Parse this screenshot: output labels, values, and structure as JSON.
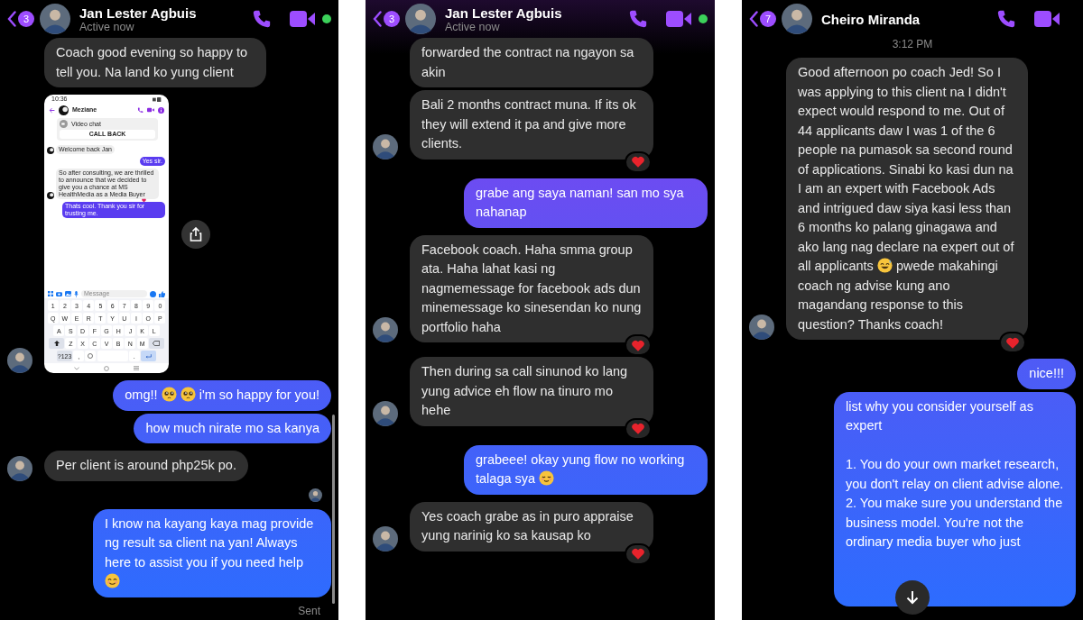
{
  "panels": [
    {
      "header": {
        "name": "Jan Lester Agbuis",
        "status": "Active now",
        "unread": "3",
        "online": true
      },
      "scroll_down": false,
      "scrollbar": true,
      "messages": [
        {
          "kind": "incoming",
          "avatar": false,
          "reaction": false,
          "parts": [
            {
              "kind": "text",
              "text": "Coach good evening so happy to tell you. Na land ko yung client"
            }
          ]
        },
        {
          "kind": "screenshot",
          "avatar": true,
          "share": true,
          "phone": {
            "time": "10:36",
            "contact": "Meziane",
            "call_title": "Video chat",
            "call_button": "CALL BACK",
            "messages": [
              {
                "kind": "incoming",
                "text": "Welcome back Jan",
                "reaction": false
              },
              {
                "kind": "outgoing",
                "text": "Yes sir.",
                "reaction": false
              },
              {
                "kind": "incoming",
                "text": "So after consulting, we are thrilled to announce that we decided to give you a chance at MS HealthMedia as a Media Buyer",
                "reaction": true
              },
              {
                "kind": "outgoing",
                "text": "Thats cool. Thank you sir for trusting me.",
                "reaction": false
              }
            ],
            "composer": {
              "placeholder": "Message"
            },
            "keys": [
              [
                "1",
                "2",
                "3",
                "4",
                "5",
                "6",
                "7",
                "8",
                "9",
                "0"
              ],
              [
                "Q",
                "W",
                "E",
                "R",
                "T",
                "Y",
                "U",
                "I",
                "O",
                "P"
              ],
              [
                "A",
                "S",
                "D",
                "F",
                "G",
                "H",
                "J",
                "K",
                "L"
              ],
              [
                "Z",
                "X",
                "C",
                "V",
                "B",
                "N",
                "M"
              ]
            ],
            "mode_key": "?123",
            "comma": ",",
            "period": "."
          }
        },
        {
          "kind": "outgoing",
          "reaction": false,
          "parts": [
            {
              "kind": "text",
              "text": "omg!!"
            },
            {
              "kind": "pleading"
            },
            {
              "kind": "pleading"
            },
            {
              "kind": "text",
              "text": "i'm so happy for you!"
            }
          ]
        },
        {
          "kind": "outgoing",
          "reaction": false,
          "parts": [
            {
              "kind": "text",
              "text": "how much nirate mo sa kanya"
            }
          ]
        },
        {
          "kind": "incoming",
          "avatar": true,
          "reaction": false,
          "parts": [
            {
              "kind": "text",
              "text": "Per client is around php25k po."
            }
          ]
        },
        {
          "kind": "receipt"
        },
        {
          "kind": "outgoing",
          "reaction": false,
          "parts": [
            {
              "kind": "text",
              "text": "I know na kayang kaya mag provide ng result sa client na yan! Always here to assist you if you need help"
            },
            {
              "kind": "smiling"
            }
          ]
        },
        {
          "kind": "status",
          "text": "Sent"
        }
      ]
    },
    {
      "header": {
        "name": "Jan Lester Agbuis",
        "status": "Active now",
        "unread": "3",
        "online": true
      },
      "scroll_down": false,
      "scrollbar": false,
      "messages": [
        {
          "kind": "incoming",
          "avatar": false,
          "reaction": false,
          "parts": [
            {
              "kind": "text",
              "text": "forwarded the contract na ngayon sa akin"
            }
          ]
        },
        {
          "kind": "incoming",
          "avatar": true,
          "reaction": true,
          "parts": [
            {
              "kind": "text",
              "text": "Bali 2 months contract muna. If its ok they will extend it pa and give more clients."
            }
          ]
        },
        {
          "kind": "outgoing",
          "reaction": false,
          "parts": [
            {
              "kind": "text",
              "text": "grabe ang saya naman! san mo sya nahanap"
            }
          ]
        },
        {
          "kind": "incoming",
          "avatar": true,
          "reaction": true,
          "parts": [
            {
              "kind": "text",
              "text": "Facebook coach. Haha smma group ata. Haha lahat kasi ng nagmemessage for facebook ads dun minemessage ko sinesendan ko nung portfolio haha"
            }
          ]
        },
        {
          "kind": "incoming",
          "avatar": true,
          "reaction": true,
          "parts": [
            {
              "kind": "text",
              "text": "Then during sa call sinunod ko lang yung advice eh flow na tinuro mo hehe"
            }
          ]
        },
        {
          "kind": "outgoing",
          "reaction": false,
          "parts": [
            {
              "kind": "text",
              "text": "grabeee! okay yung flow no working talaga sya"
            },
            {
              "kind": "relieved"
            }
          ]
        },
        {
          "kind": "incoming",
          "avatar": true,
          "reaction": true,
          "parts": [
            {
              "kind": "text",
              "text": "Yes coach grabe as in puro appraise yung narinig ko sa kausap ko"
            }
          ]
        }
      ]
    },
    {
      "header": {
        "name": "Cheiro Miranda",
        "unread": "7",
        "online": false
      },
      "scroll_down": true,
      "scrollbar": false,
      "messages": [
        {
          "kind": "timestamp",
          "text": "3:12 PM"
        },
        {
          "kind": "incoming",
          "avatar": true,
          "reaction": true,
          "parts": [
            {
              "kind": "text",
              "text": "Good afternoon po coach Jed! So I was applying to this client na I didn't expect would respond to me. Out of 44 applicants daw I was 1 of the 6 people na pumasok sa second round of applications. Sinabi ko kasi dun na I am an expert with Facebook Ads and intrigued daw siya kasi less than 6 months ko palang ginagawa and ako lang nag declare na expert out of all applicants"
            },
            {
              "kind": "sweat"
            },
            {
              "kind": "text",
              "text": "pwede makahingi coach ng advise kung ano magandang response to this question? Thanks coach!"
            }
          ]
        },
        {
          "kind": "outgoing",
          "reaction": false,
          "parts": [
            {
              "kind": "text",
              "text": "nice!!!"
            }
          ]
        },
        {
          "kind": "outgoing",
          "reaction": false,
          "cut": true,
          "parts": [
            {
              "kind": "text",
              "text": "list why you consider yourself as expert\n\n1. You do your own market research, you don't relay on client advise alone.\n2. You make sure you understand the business model. You're not the ordinary media buyer who just"
            }
          ]
        }
      ]
    }
  ]
}
